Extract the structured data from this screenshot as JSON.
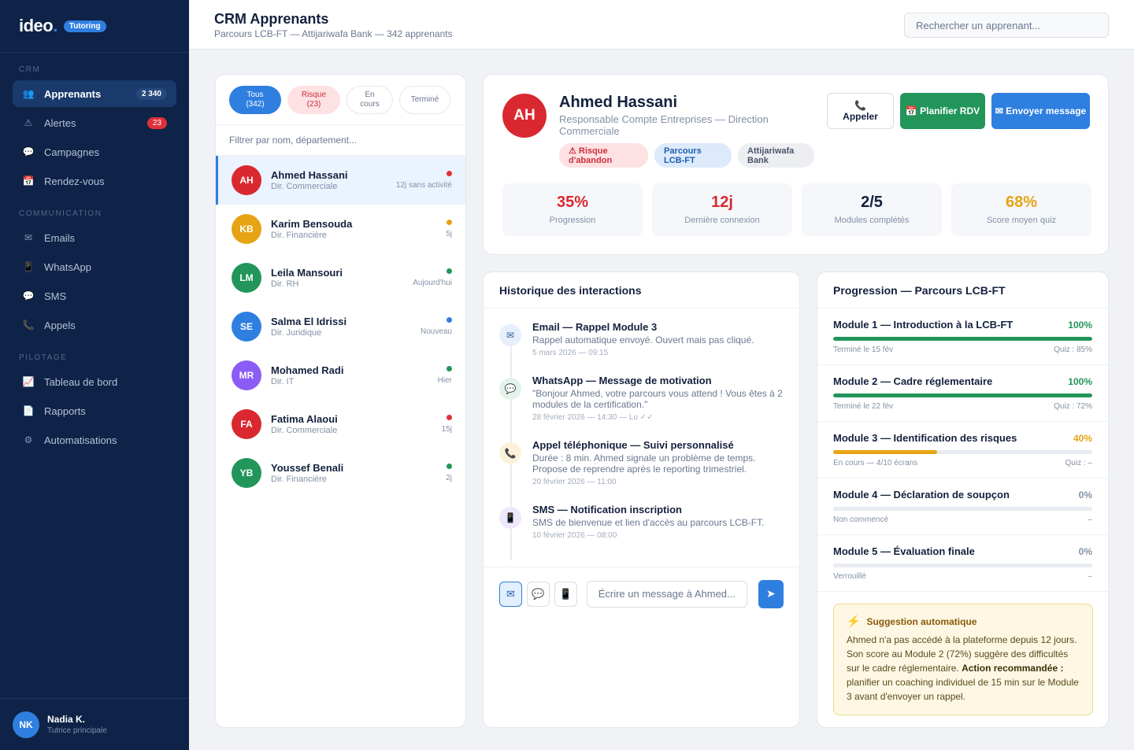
{
  "brand": {
    "logo": "ideo",
    "logo_dot": ".",
    "badge": "Tutoring"
  },
  "sidebar": {
    "sections": [
      {
        "heading": "CRM",
        "items": [
          {
            "label": "Apprenants",
            "icon": "users-icon",
            "count": "2 340",
            "active": true
          },
          {
            "label": "Alertes",
            "icon": "warning-icon",
            "count": "23",
            "count_color": "#e0303b"
          },
          {
            "label": "Campagnes",
            "icon": "chat-bubble-icon"
          },
          {
            "label": "Rendez-vous",
            "icon": "calendar-icon"
          }
        ]
      },
      {
        "heading": "COMMUNICATION",
        "items": [
          {
            "label": "Emails",
            "icon": "envelope-icon"
          },
          {
            "label": "WhatsApp",
            "icon": "phone-device-icon"
          },
          {
            "label": "SMS",
            "icon": "chat-bubble-icon"
          },
          {
            "label": "Appels",
            "icon": "phone-icon"
          }
        ]
      },
      {
        "heading": "PILOTAGE",
        "items": [
          {
            "label": "Tableau de bord",
            "icon": "chart-icon"
          },
          {
            "label": "Rapports",
            "icon": "document-icon"
          },
          {
            "label": "Automatisations",
            "icon": "gear-icon"
          }
        ]
      }
    ],
    "user": {
      "initials": "NK",
      "name": "Nadia K.",
      "role": "Tutrice principale"
    }
  },
  "header": {
    "title": "CRM Apprenants",
    "subtitle": "Parcours LCB-FT — Attijariwafa Bank — 342 apprenants",
    "search_placeholder": "Rechercher un apprenant..."
  },
  "list": {
    "filters": {
      "all": "Tous\n(342)",
      "risk": "Risque\n(23)",
      "in_progress": "En\ncours",
      "done": "Terminé"
    },
    "filter_placeholder": "Filtrer par nom, département...",
    "learners": [
      {
        "initials": "AH",
        "name": "Ahmed Hassani",
        "dept": "Dir. Commerciale",
        "status": "12j sans activité",
        "color": "#d9282f",
        "dot": "#e0303b"
      },
      {
        "initials": "KB",
        "name": "Karim Bensouda",
        "dept": "Dir. Financière",
        "status": "5j",
        "color": "#e6a414",
        "dot": "#e6a414"
      },
      {
        "initials": "LM",
        "name": "Leila Mansouri",
        "dept": "Dir. RH",
        "status": "Aujourd'hui",
        "color": "#22955a",
        "dot": "#22955a"
      },
      {
        "initials": "SE",
        "name": "Salma El Idrissi",
        "dept": "Dir. Juridique",
        "status": "Nouveau",
        "color": "#2f7fe0",
        "dot": "#2f7fe0"
      },
      {
        "initials": "MR",
        "name": "Mohamed Radi",
        "dept": "Dir. IT",
        "status": "Hier",
        "color": "#8b5cf6",
        "dot": "#22955a"
      },
      {
        "initials": "FA",
        "name": "Fatima Alaoui",
        "dept": "Dir. Commerciale",
        "status": "15j",
        "color": "#d9282f",
        "dot": "#e0303b"
      },
      {
        "initials": "YB",
        "name": "Youssef Benali",
        "dept": "Dir. Financière",
        "status": "2j",
        "color": "#22955a",
        "dot": "#22955a"
      }
    ]
  },
  "profile": {
    "initials": "AH",
    "name": "Ahmed Hassani",
    "role": "Responsable Compte Entreprises — Direction Commerciale",
    "tags": {
      "risk": "⚠ Risque d'abandon",
      "course": "Parcours LCB-FT",
      "bank": "Attijariwafa Bank"
    },
    "actions": {
      "call_icon": "📞",
      "call": "Appeler",
      "rdv_icon": "📅",
      "rdv": "Planifier RDV",
      "msg": "✉ Envoyer message"
    },
    "stats": [
      {
        "value": "35%",
        "label": "Progression",
        "color": "#d9282f"
      },
      {
        "value": "12j",
        "label": "Dernière connexion",
        "color": "#d9282f"
      },
      {
        "value": "2/5",
        "label": "Modules complétés",
        "color": "#14213d"
      },
      {
        "value": "68%",
        "label": "Score moyen quiz",
        "color": "#e6a414"
      }
    ]
  },
  "history": {
    "title": "Historique des interactions",
    "events": [
      {
        "icon": "envelope-icon",
        "glyph": "✉",
        "bg": "#e6effb",
        "fg": "#2f5f9e",
        "title": "Email — Rappel Module 3",
        "desc": "Rappel automatique envoyé. Ouvert mais pas cliqué.",
        "date": "5 mars 2026 — 09:15"
      },
      {
        "icon": "chat-bubble-icon",
        "glyph": "💬",
        "bg": "#e3f3ea",
        "fg": "#22955a",
        "title": "WhatsApp — Message de motivation",
        "desc": "\"Bonjour Ahmed, votre parcours vous attend ! Vous êtes à 2 modules de la certification.\"",
        "date": "28 février 2026 — 14:30 — Lu ✓✓"
      },
      {
        "icon": "phone-icon",
        "glyph": "📞",
        "bg": "#fdf1dc",
        "fg": "#c97f08",
        "title": "Appel téléphonique — Suivi personnalisé",
        "desc": "Durée : 8 min. Ahmed signale un problème de temps. Propose de reprendre après le reporting trimestriel.",
        "date": "20 février 2026 — 11:00"
      },
      {
        "icon": "phone-device-icon",
        "glyph": "📱",
        "bg": "#efe8fc",
        "fg": "#7c4ddb",
        "title": "SMS — Notification inscription",
        "desc": "SMS de bienvenue et lien d'accès au parcours LCB-FT.",
        "date": "10 février 2026 — 08:00"
      }
    ],
    "composer": {
      "placeholder": "Écrire un message à Ahmed...",
      "email_glyph": "✉",
      "whatsapp_glyph": "💬",
      "sms_glyph": "📱",
      "send_glyph": "➤"
    }
  },
  "progress": {
    "title": "Progression — Parcours LCB-FT",
    "modules": [
      {
        "title": "Module 1 — Introduction à la LCB-FT",
        "pct_label": "100%",
        "pct": 100,
        "color": "#22955a",
        "status": "Terminé le 15 fév",
        "quiz": "Quiz : 85%"
      },
      {
        "title": "Module 2 — Cadre réglementaire",
        "pct_label": "100%",
        "pct": 100,
        "color": "#22955a",
        "status": "Terminé le 22 fév",
        "quiz": "Quiz : 72%"
      },
      {
        "title": "Module 3 — Identification des risques",
        "pct_label": "40%",
        "pct": 40,
        "color": "#e6a414",
        "status": "En cours — 4/10 écrans",
        "quiz": "Quiz : –"
      },
      {
        "title": "Module 4 — Déclaration de soupçon",
        "pct_label": "0%",
        "pct": 0,
        "color": "#8391a7",
        "status": "Non commencé",
        "quiz": "–"
      },
      {
        "title": "Module 5 — Évaluation finale",
        "pct_label": "0%",
        "pct": 0,
        "color": "#8391a7",
        "status": "Verrouillé",
        "quiz": "–"
      }
    ],
    "suggestion": {
      "icon": "⚡",
      "title": "Suggestion automatique",
      "text_before": "Ahmed n'a pas accédé à la plateforme depuis 12 jours. Son score au Module 2 (72%) suggère des difficultés sur le cadre réglementaire. ",
      "text_bold": "Action recommandée :",
      "text_after": " planifier un coaching individuel de 15 min sur le Module 3 avant d'envoyer un rappel."
    }
  }
}
